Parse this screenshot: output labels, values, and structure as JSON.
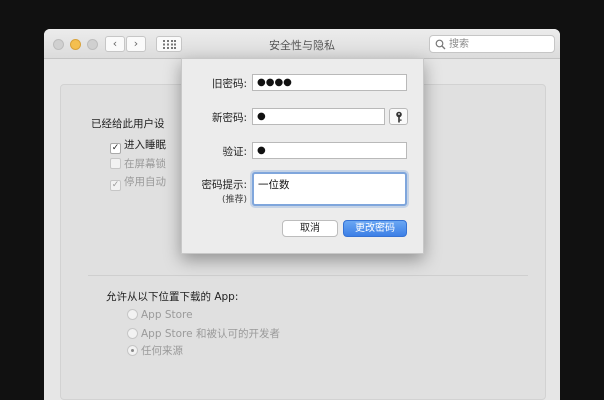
{
  "window": {
    "title": "安全性与隐私"
  },
  "toolbar": {
    "back_glyph": "‹",
    "forward_glyph": "›",
    "search_placeholder": "搜索",
    "icons": [
      "search-icon",
      "grid-icon"
    ]
  },
  "pane": {
    "general_label": "已经给此用户设",
    "options": [
      {
        "label": "进入睡眠",
        "checked": true,
        "enabled": true
      },
      {
        "label": "在屏幕锁",
        "checked": false,
        "enabled": false
      },
      {
        "label": "停用自动",
        "checked": true,
        "enabled": false
      }
    ],
    "download_label": "允许从以下位置下载的 App:",
    "download_options": [
      {
        "label": "App Store",
        "selected": false
      },
      {
        "label": "App Store 和被认可的开发者",
        "selected": false
      },
      {
        "label": "任何来源",
        "selected": true
      }
    ]
  },
  "dialog": {
    "old_password_label": "旧密码:",
    "old_password_value": "●●●●",
    "new_password_label": "新密码:",
    "new_password_value": "●",
    "verify_label": "验证:",
    "verify_value": "●",
    "hint_label": "密码提示:",
    "hint_sublabel": "(推荐)",
    "hint_value": "一位数",
    "cancel_label": "取消",
    "confirm_label": "更改密码",
    "accent_color": "#3c7fe6"
  }
}
